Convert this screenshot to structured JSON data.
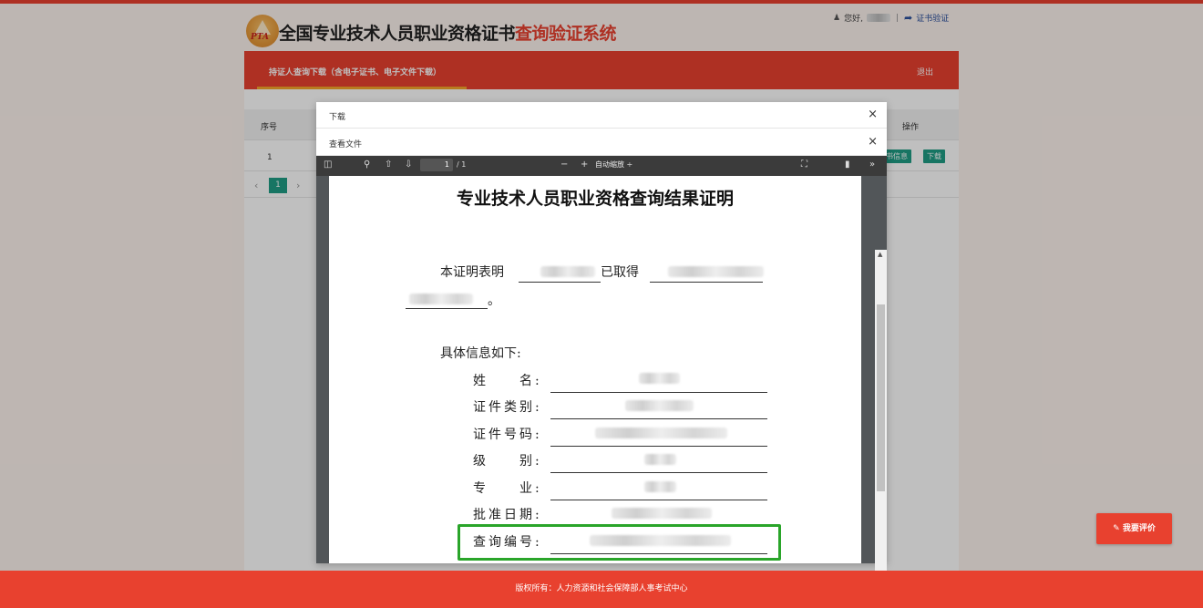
{
  "header": {
    "logo_text": "PTA",
    "title_main": "全国专业技术人员职业资格证书",
    "title_highlight": "查询验证系统",
    "greeting": "您好,",
    "separator": "|",
    "verify_link": "证书验证"
  },
  "nav": {
    "tab": "持证人查询下载（含电子证书、电子文件下载）",
    "logout": "退出"
  },
  "table": {
    "col_no": "序号",
    "col_op": "操作",
    "row_no": "1",
    "btn_info": "书信息",
    "btn_download": "下载",
    "page_current": "1",
    "prev": "‹",
    "next": "›"
  },
  "modal": {
    "title": "下载",
    "sub_title": "查看文件",
    "close": "×"
  },
  "pdf_toolbar": {
    "page_input": "1",
    "page_total": "/ 1",
    "zoom_minus": "−",
    "zoom_plus": "+",
    "zoom_label": "自动缩放 ÷",
    "more": "»"
  },
  "document": {
    "title": "专业技术人员职业资格查询结果证明",
    "intro_prefix": "本证明表明",
    "intro_mid": "已取得",
    "intro_end": "。",
    "details_heading": "具体信息如下:",
    "fields": [
      {
        "label": "姓　　名:"
      },
      {
        "label": "证件类别:"
      },
      {
        "label": "证件号码:"
      },
      {
        "label": "级　　别:"
      },
      {
        "label": "专　　业:"
      },
      {
        "label": "批准日期:"
      },
      {
        "label": "查询编号:"
      }
    ]
  },
  "rate_button": "我要评价",
  "footer": "版权所有：人力资源和社会保障部人事考试中心",
  "colors": {
    "brand_red": "#e8412f",
    "teal": "#1f9c85",
    "highlight_green": "#2aa52a"
  }
}
